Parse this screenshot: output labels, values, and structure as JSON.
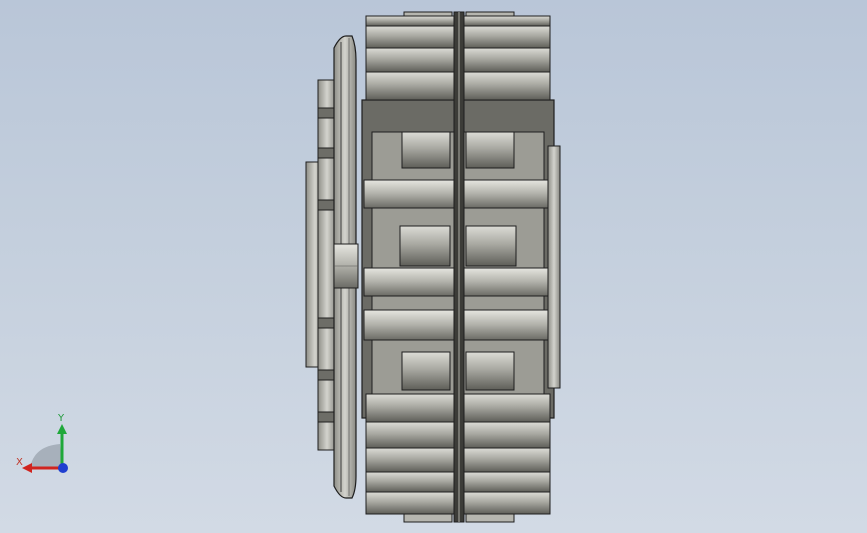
{
  "viewport": {
    "background_top": "#b9c6d8",
    "background_bottom": "#d2dae5"
  },
  "model": {
    "name": "clutch-brake-assembly",
    "view": "front",
    "colors": {
      "metal_light": "#c9c9c3",
      "metal_mid": "#a2a29a",
      "metal_dark": "#62625c",
      "edge": "#1e1e1e"
    }
  },
  "triad": {
    "x_label": "X",
    "y_label": "Y",
    "x_color": "#d0241f",
    "y_color": "#1fa83a",
    "z_color": "#1f3fd0"
  }
}
